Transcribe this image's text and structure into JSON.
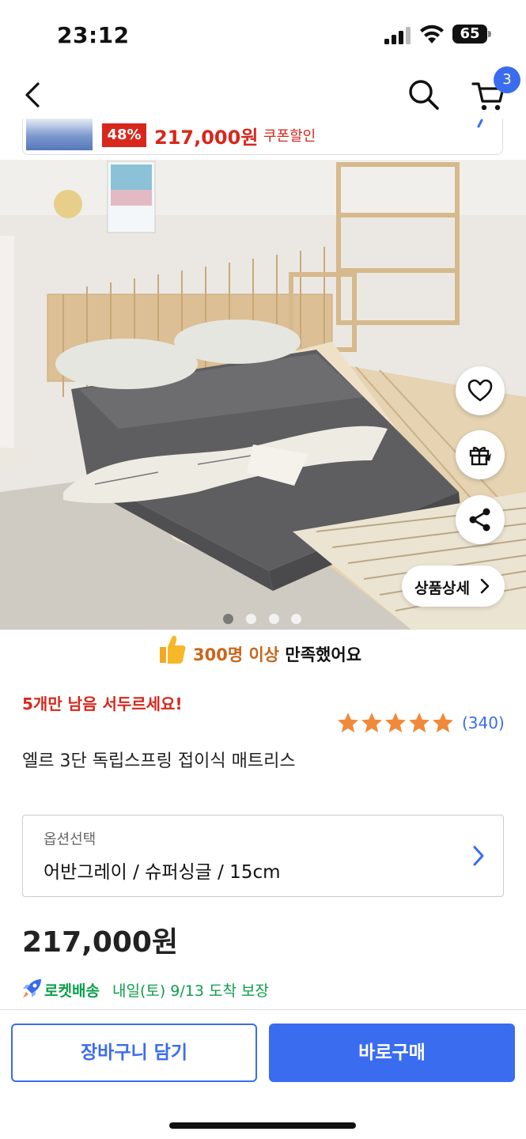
{
  "status_bar": {
    "time": "23:12",
    "battery": "65"
  },
  "nav": {
    "cart_count": "3"
  },
  "promo": {
    "discount": "48%",
    "price": "217,000원",
    "coupon": "쿠폰할인"
  },
  "hero": {
    "detail_label": "상품상세",
    "slide_index": 1,
    "slide_total": 4
  },
  "satisfaction": {
    "highlight": "300명 이상",
    "text": " 만족했어요"
  },
  "product": {
    "stock_notice": "5개만 남음 서두르세요!",
    "rating": 5,
    "rating_count": "(340)",
    "title": "엘르 3단 독립스프링 접이식 매트리스",
    "option_label": "옵션선택",
    "option_value": "어반그레이 / 슈퍼싱글 / 15cm",
    "price": "217,000원",
    "delivery_brand": "로켓배송",
    "delivery_date": "내일(토) 9/13 도착 보장"
  },
  "actions": {
    "cart_label": "장바구니 담기",
    "buy_label": "바로구매"
  },
  "colors": {
    "accent": "#3a6cf0",
    "sale": "#d8271c",
    "rocket": "#0d9e4b",
    "star": "#f08a3a"
  },
  "icons": [
    "back-icon",
    "search-icon",
    "cart-icon",
    "heart-icon",
    "gift-icon",
    "share-icon",
    "chevron-right-icon",
    "thumbs-up-icon",
    "star-icon",
    "rocket-icon"
  ]
}
